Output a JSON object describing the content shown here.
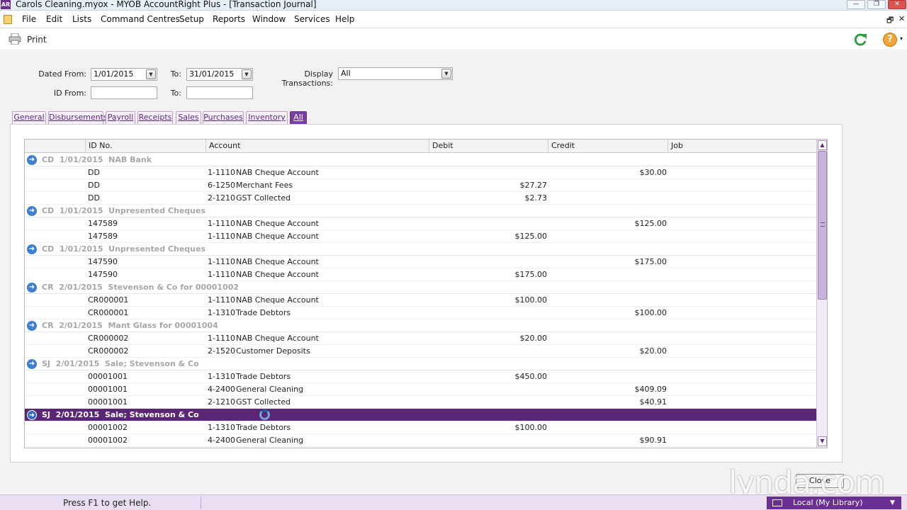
{
  "window": {
    "title": "Carols Cleaning.myox - MYOB AccountRight Plus - [Transaction Journal]",
    "app_icon_text": "AR",
    "minimize": "—",
    "restore": "❐",
    "close": "✕"
  },
  "menu": {
    "items": [
      "File",
      "Edit",
      "Lists",
      "Command Centres",
      "Setup",
      "Reports",
      "Window",
      "Services",
      "Help"
    ],
    "mdi_restore": "🗗",
    "mdi_close": "✕"
  },
  "toolbar": {
    "print_label": "Print",
    "help_symbol": "?",
    "help_caret": "▾"
  },
  "filters": {
    "dated_from_label": "Dated From:",
    "dated_from_value": "1/01/2015",
    "to_label": "To:",
    "dated_to_value": "31/01/2015",
    "display_label": "Display Transactions:",
    "display_value": "All",
    "id_from_label": "ID From:",
    "id_from_value": "",
    "id_to_label": "To:",
    "id_to_value": "",
    "dropdown_glyph": "▼"
  },
  "tabs": [
    "General",
    "Disbursements",
    "Payroll",
    "Receipts",
    "Sales",
    "Purchases",
    "Inventory",
    "All"
  ],
  "active_tab": "All",
  "columns": [
    "ID No.",
    "Account",
    "Debit",
    "Credit",
    "Job"
  ],
  "groups": [
    {
      "header": "CD  1/01/2015  NAB Bank",
      "selected": false,
      "lines": [
        {
          "id": "DD",
          "acct": "1-1110",
          "name": "NAB Cheque Account",
          "debit": "",
          "credit": "$30.00"
        },
        {
          "id": "DD",
          "acct": "6-1250",
          "name": "Merchant Fees",
          "debit": "$27.27",
          "credit": ""
        },
        {
          "id": "DD",
          "acct": "2-1210",
          "name": "GST Collected",
          "debit": "$2.73",
          "credit": ""
        }
      ]
    },
    {
      "header": "CD  1/01/2015  Unpresented Cheques",
      "selected": false,
      "lines": [
        {
          "id": "147589",
          "acct": "1-1110",
          "name": "NAB Cheque Account",
          "debit": "",
          "credit": "$125.00"
        },
        {
          "id": "147589",
          "acct": "1-1110",
          "name": "NAB Cheque Account",
          "debit": "$125.00",
          "credit": ""
        }
      ]
    },
    {
      "header": "CD  1/01/2015  Unpresented Cheques",
      "selected": false,
      "lines": [
        {
          "id": "147590",
          "acct": "1-1110",
          "name": "NAB Cheque Account",
          "debit": "",
          "credit": "$175.00"
        },
        {
          "id": "147590",
          "acct": "1-1110",
          "name": "NAB Cheque Account",
          "debit": "$175.00",
          "credit": ""
        }
      ]
    },
    {
      "header": "CR  2/01/2015  Stevenson & Co for 00001002",
      "selected": false,
      "lines": [
        {
          "id": "CR000001",
          "acct": "1-1110",
          "name": "NAB Cheque Account",
          "debit": "$100.00",
          "credit": ""
        },
        {
          "id": "CR000001",
          "acct": "1-1310",
          "name": "Trade Debtors",
          "debit": "",
          "credit": "$100.00"
        }
      ]
    },
    {
      "header": "CR  2/01/2015  Mant Glass for 00001004",
      "selected": false,
      "lines": [
        {
          "id": "CR000002",
          "acct": "1-1110",
          "name": "NAB Cheque Account",
          "debit": "$20.00",
          "credit": ""
        },
        {
          "id": "CR000002",
          "acct": "2-1520",
          "name": "Customer Deposits",
          "debit": "",
          "credit": "$20.00"
        }
      ]
    },
    {
      "header": "SJ  2/01/2015  Sale; Stevenson & Co",
      "selected": false,
      "lines": [
        {
          "id": "00001001",
          "acct": "1-1310",
          "name": "Trade Debtors",
          "debit": "$450.00",
          "credit": ""
        },
        {
          "id": "00001001",
          "acct": "4-2400",
          "name": "General Cleaning",
          "debit": "",
          "credit": "$409.09"
        },
        {
          "id": "00001001",
          "acct": "2-1210",
          "name": "GST Collected",
          "debit": "",
          "credit": "$40.91"
        }
      ]
    },
    {
      "header": "SJ  2/01/2015  Sale; Stevenson & Co",
      "selected": true,
      "lines": [
        {
          "id": "00001002",
          "acct": "1-1310",
          "name": "Trade Debtors",
          "debit": "$100.00",
          "credit": ""
        },
        {
          "id": "00001002",
          "acct": "4-2400",
          "name": "General Cleaning",
          "debit": "",
          "credit": "$90.91"
        }
      ]
    }
  ],
  "group_arrow": "➜",
  "scroll": {
    "up": "▲",
    "down": "▼"
  },
  "close_button": "Close",
  "watermark": "lynda.com",
  "status": {
    "help_text": "Press F1 to get Help.",
    "library": "Local (My Library)",
    "library_caret": "▼"
  },
  "colors": {
    "accent_purple": "#5b2674",
    "tab_active": "#7a3fa3",
    "group_text": "#a7a7a7",
    "arrow_blue": "#3f7ed0",
    "refresh_green": "#2e9e3e",
    "help_orange": "#f1a43a"
  },
  "icons": [
    "print-icon",
    "refresh-icon",
    "help-icon",
    "arrow-right-icon",
    "pc-icon"
  ]
}
